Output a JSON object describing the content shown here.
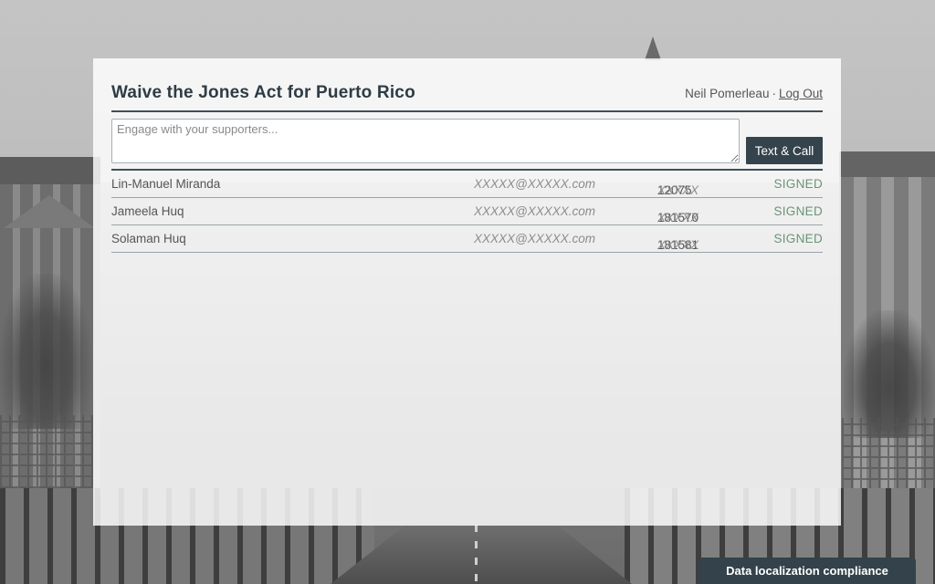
{
  "campaign": {
    "title": "Waive the Jones Act for Puerto Rico"
  },
  "user": {
    "name": "Neil Pomerleau",
    "separator": "·",
    "logout_label": "Log Out"
  },
  "composer": {
    "placeholder": "Engage with your supporters...",
    "value": "",
    "send_label": "Text & Call"
  },
  "supporters": [
    {
      "name": "Lin-Manuel Miranda",
      "email": "XXXXX@XXXXX.com",
      "phone_prefix": "12075",
      "phone_mask": "XXXXX",
      "status": "SIGNED"
    },
    {
      "name": "Jameela Huq",
      "email": "XXXXX@XXXXX.com",
      "phone_prefix": "181570",
      "phone_mask": "XXXXX",
      "status": "SIGNED"
    },
    {
      "name": "Solaman Huq",
      "email": "XXXXX@XXXXX.com",
      "phone_prefix": "181581",
      "phone_mask": "XXXXX",
      "status": "SIGNED"
    }
  ],
  "footer": {
    "compliance_label": "Data localization compliance"
  },
  "colors": {
    "primary": "#34434c",
    "signed": "#6a9475",
    "masked_text": "#8c8c8c"
  }
}
